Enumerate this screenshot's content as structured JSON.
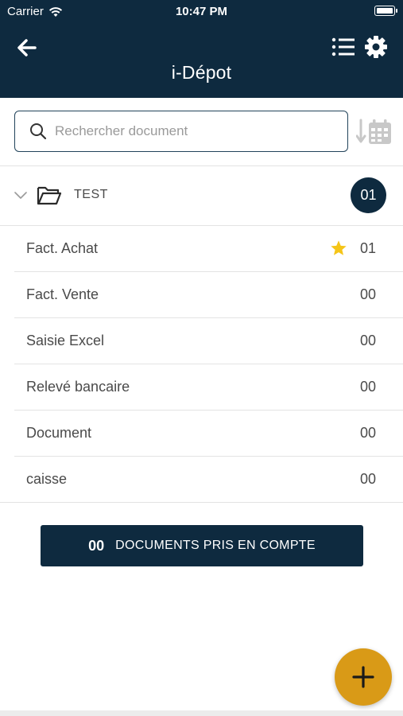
{
  "status_bar": {
    "carrier": "Carrier",
    "time": "10:47 PM"
  },
  "header": {
    "title": "i-Dépot"
  },
  "search": {
    "placeholder": "Rechercher document",
    "value": ""
  },
  "folder": {
    "name": "TEST",
    "count": "01"
  },
  "documents": [
    {
      "name": "Fact. Achat",
      "count": "01",
      "starred": true
    },
    {
      "name": "Fact. Vente",
      "count": "00"
    },
    {
      "name": "Saisie Excel",
      "count": "00"
    },
    {
      "name": "Relevé bancaire",
      "count": "00"
    },
    {
      "name": "Document",
      "count": "00"
    },
    {
      "name": "caisse",
      "count": "00"
    }
  ],
  "summary": {
    "count": "00",
    "label": "DOCUMENTS PRIS EN COMPTE"
  },
  "colors": {
    "primary": "#0e2a3f",
    "accent": "#d99a17",
    "star": "#f5c518"
  },
  "icons": [
    "wifi-icon",
    "battery-icon",
    "back-arrow-icon",
    "list-icon",
    "gear-icon",
    "search-icon",
    "sort-date-icon",
    "chevron-down-icon",
    "folder-icon",
    "star-icon",
    "plus-icon"
  ]
}
